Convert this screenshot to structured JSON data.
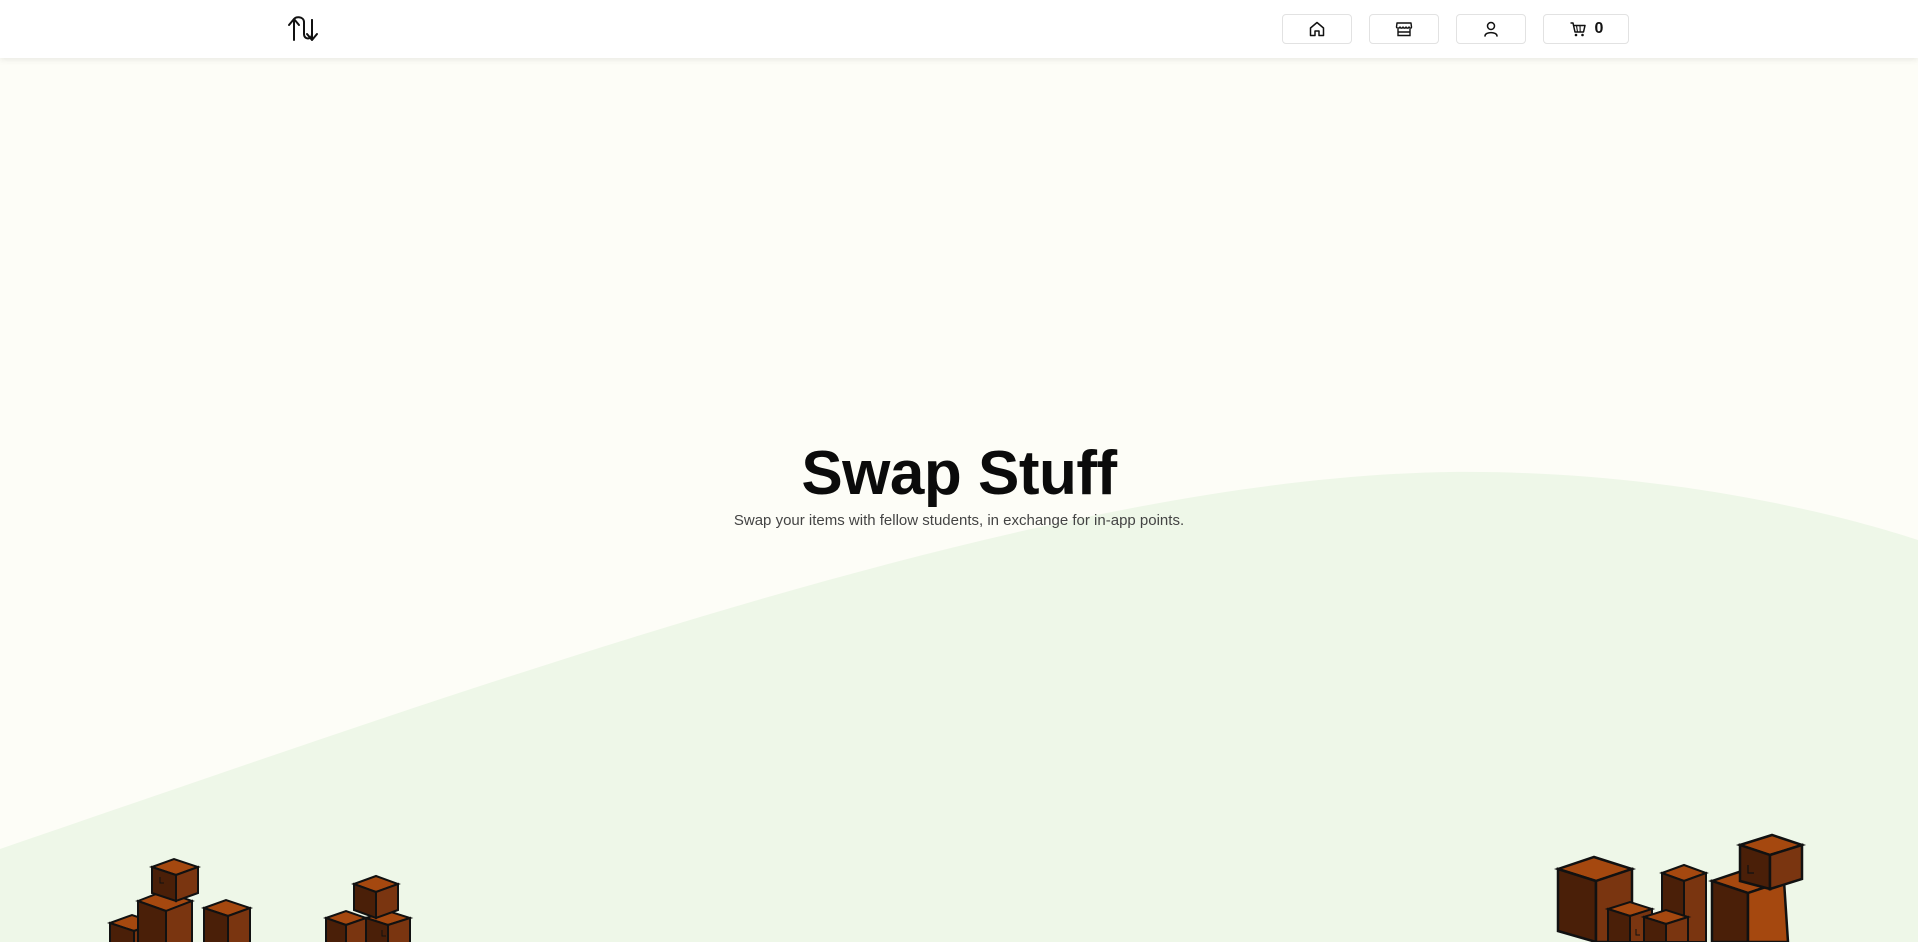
{
  "navbar": {
    "logo_icon": "swap-arrows-icon",
    "home_icon": "home-icon",
    "store_icon": "store-icon",
    "profile_icon": "user-icon",
    "cart_icon": "cart-icon",
    "cart_count": "0"
  },
  "hero": {
    "title": "Swap Stuff",
    "subtitle": "Swap your items with fellow students, in exchange for in-app points."
  },
  "colors": {
    "background": "#fdfdf7",
    "wave": "#eef7e8",
    "box_dark": "#4a1f08",
    "box_mid": "#7a3510",
    "box_light": "#a5480f"
  }
}
